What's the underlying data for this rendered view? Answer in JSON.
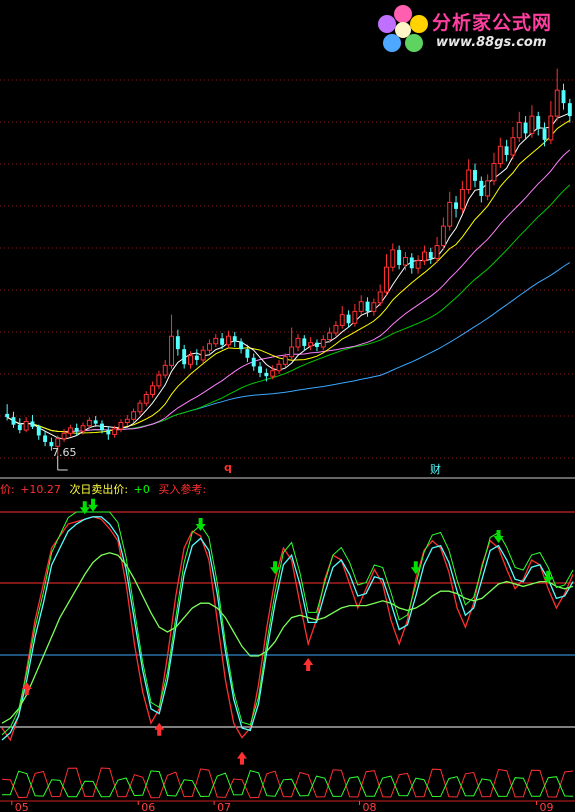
{
  "watermark": {
    "title": "分析家公式网",
    "url": "www.88gs.com"
  },
  "indicator_header": {
    "label_price": "价:",
    "value_price": "+10.27",
    "label_next": "次日卖出价:",
    "value_next": "+0",
    "label_buy": "买入参考:"
  },
  "annotations": {
    "low_price": "7.65",
    "marker_q": "q",
    "marker_cai": "财"
  },
  "colors": {
    "up": "#ff3232",
    "down": "#54ffff",
    "ma5": "#ffffff",
    "ma10": "#ffff00",
    "ma20": "#ff80ff",
    "ma30": "#00c800",
    "ma60": "#3aa8ff",
    "buy_arrow": "#ff3030",
    "sell_arrow": "#00e000"
  },
  "chart_data": [
    {
      "type": "candlestick",
      "title": "",
      "min_label": "7.65",
      "candles": [
        [
          9.6,
          9.45,
          10.05,
          9.3
        ],
        [
          9.45,
          9.1,
          9.7,
          8.95
        ],
        [
          9.1,
          8.85,
          9.4,
          8.7
        ],
        [
          8.85,
          9.25,
          9.45,
          8.75
        ],
        [
          9.25,
          9.0,
          9.55,
          8.9
        ],
        [
          9.0,
          8.6,
          9.1,
          8.4
        ],
        [
          8.6,
          8.3,
          8.8,
          8.1
        ],
        [
          8.3,
          8.1,
          8.5,
          7.9
        ],
        [
          8.1,
          8.45,
          8.6,
          7.65
        ],
        [
          8.45,
          8.7,
          8.9,
          8.3
        ],
        [
          8.7,
          8.95,
          9.1,
          8.55
        ],
        [
          8.95,
          8.8,
          9.15,
          8.6
        ],
        [
          8.8,
          9.05,
          9.2,
          8.65
        ],
        [
          9.05,
          9.3,
          9.45,
          8.9
        ],
        [
          9.3,
          9.15,
          9.5,
          9.0
        ],
        [
          9.15,
          8.85,
          9.3,
          8.7
        ],
        [
          8.85,
          8.65,
          9.0,
          8.4
        ],
        [
          8.65,
          8.9,
          9.05,
          8.5
        ],
        [
          8.9,
          9.2,
          9.35,
          8.75
        ],
        [
          9.2,
          9.35,
          9.55,
          9.05
        ],
        [
          9.35,
          9.7,
          9.85,
          9.2
        ],
        [
          9.7,
          10.1,
          10.25,
          9.55
        ],
        [
          10.1,
          10.5,
          10.65,
          9.95
        ],
        [
          10.5,
          10.9,
          11.1,
          10.35
        ],
        [
          10.9,
          11.4,
          11.6,
          10.75
        ],
        [
          11.4,
          11.85,
          12.1,
          11.25
        ],
        [
          11.85,
          13.2,
          14.2,
          11.7
        ],
        [
          13.2,
          12.6,
          13.5,
          12.3
        ],
        [
          12.6,
          11.9,
          12.8,
          11.7
        ],
        [
          11.9,
          12.3,
          12.5,
          11.7
        ],
        [
          12.3,
          12.1,
          12.6,
          11.85
        ],
        [
          12.1,
          12.55,
          12.75,
          11.95
        ],
        [
          12.55,
          12.85,
          13.05,
          12.4
        ],
        [
          12.85,
          13.1,
          13.3,
          12.7
        ],
        [
          13.1,
          12.8,
          13.35,
          12.6
        ],
        [
          12.8,
          13.2,
          13.45,
          12.65
        ],
        [
          13.2,
          12.95,
          13.4,
          12.7
        ],
        [
          12.95,
          12.6,
          13.1,
          12.4
        ],
        [
          12.6,
          12.2,
          12.8,
          12.0
        ],
        [
          12.2,
          11.8,
          12.4,
          11.6
        ],
        [
          11.8,
          11.5,
          12.0,
          11.3
        ],
        [
          11.5,
          11.35,
          11.7,
          11.1
        ],
        [
          11.35,
          11.6,
          11.85,
          11.2
        ],
        [
          11.6,
          11.9,
          12.1,
          11.45
        ],
        [
          11.9,
          12.25,
          12.4,
          11.75
        ],
        [
          12.25,
          12.7,
          13.6,
          12.1
        ],
        [
          12.7,
          13.1,
          13.3,
          12.5
        ],
        [
          13.1,
          12.75,
          13.25,
          12.55
        ],
        [
          12.75,
          12.9,
          13.15,
          12.55
        ],
        [
          12.9,
          12.7,
          13.05,
          12.5
        ],
        [
          12.7,
          13.05,
          13.25,
          12.55
        ],
        [
          13.05,
          13.35,
          13.6,
          12.9
        ],
        [
          13.35,
          13.7,
          13.9,
          13.2
        ],
        [
          13.7,
          14.2,
          14.6,
          13.55
        ],
        [
          14.2,
          13.8,
          14.4,
          13.6
        ],
        [
          13.8,
          14.35,
          14.7,
          13.65
        ],
        [
          14.35,
          14.8,
          15.1,
          14.2
        ],
        [
          14.8,
          14.35,
          15.0,
          14.1
        ],
        [
          14.35,
          14.75,
          14.95,
          14.15
        ],
        [
          14.75,
          15.25,
          15.6,
          14.6
        ],
        [
          15.25,
          16.4,
          17.0,
          15.1
        ],
        [
          16.4,
          17.2,
          17.5,
          16.2
        ],
        [
          17.2,
          16.5,
          17.4,
          16.3
        ],
        [
          16.5,
          16.85,
          17.1,
          16.25
        ],
        [
          16.85,
          16.35,
          17.05,
          16.1
        ],
        [
          16.35,
          16.7,
          16.95,
          16.1
        ],
        [
          16.7,
          17.1,
          17.4,
          16.5
        ],
        [
          17.1,
          16.8,
          17.3,
          16.55
        ],
        [
          16.8,
          17.4,
          17.8,
          16.6
        ],
        [
          17.4,
          18.3,
          18.7,
          17.2
        ],
        [
          18.3,
          19.4,
          19.9,
          18.1
        ],
        [
          19.4,
          19.1,
          19.7,
          18.7
        ],
        [
          19.1,
          20.0,
          20.4,
          18.9
        ],
        [
          20.0,
          20.9,
          21.4,
          19.8
        ],
        [
          20.9,
          20.4,
          21.2,
          20.1
        ],
        [
          20.4,
          19.7,
          20.6,
          19.4
        ],
        [
          19.7,
          20.4,
          20.7,
          19.5
        ],
        [
          20.4,
          21.2,
          21.7,
          20.2
        ],
        [
          21.2,
          22.0,
          22.4,
          21.0
        ],
        [
          22.0,
          21.6,
          22.3,
          21.3
        ],
        [
          21.6,
          22.4,
          22.9,
          21.4
        ],
        [
          22.4,
          23.1,
          23.6,
          22.2
        ],
        [
          23.1,
          22.6,
          23.4,
          22.3
        ],
        [
          22.6,
          23.4,
          23.9,
          22.4
        ],
        [
          23.4,
          22.8,
          23.6,
          22.5
        ],
        [
          22.8,
          22.3,
          23.1,
          22.0
        ],
        [
          22.3,
          23.4,
          24.1,
          22.1
        ],
        [
          23.4,
          24.6,
          25.6,
          23.2
        ],
        [
          24.6,
          24.0,
          24.9,
          23.7
        ],
        [
          24.0,
          23.4,
          24.2,
          23.1
        ]
      ],
      "ylim": [
        7.0,
        26.0
      ]
    },
    {
      "type": "line",
      "title": "",
      "series": [
        {
          "values": [
            0.1,
            0.05,
            0.15,
            0.35,
            0.55,
            0.7,
            0.85,
            0.9,
            0.95,
            0.96,
            0.97,
            0.98,
            0.97,
            0.93,
            0.88,
            0.7,
            0.45,
            0.25,
            0.12,
            0.18,
            0.4,
            0.65,
            0.85,
            0.92,
            0.9,
            0.8,
            0.55,
            0.3,
            0.12,
            0.06,
            0.1,
            0.28,
            0.52,
            0.72,
            0.85,
            0.8,
            0.62,
            0.45,
            0.55,
            0.72,
            0.82,
            0.8,
            0.7,
            0.6,
            0.68,
            0.76,
            0.7,
            0.55,
            0.45,
            0.55,
            0.72,
            0.84,
            0.88,
            0.85,
            0.75,
            0.6,
            0.52,
            0.62,
            0.78,
            0.88,
            0.85,
            0.76,
            0.68,
            0.72,
            0.8,
            0.78,
            0.68,
            0.6,
            0.66,
            0.74
          ]
        },
        {
          "values": [
            0.05,
            0.08,
            0.15,
            0.3,
            0.48,
            0.62,
            0.78,
            0.85,
            0.92,
            0.95,
            0.97,
            0.98,
            0.98,
            0.95,
            0.9,
            0.76,
            0.55,
            0.34,
            0.18,
            0.16,
            0.3,
            0.52,
            0.74,
            0.86,
            0.89,
            0.84,
            0.66,
            0.42,
            0.22,
            0.1,
            0.09,
            0.2,
            0.42,
            0.62,
            0.78,
            0.82,
            0.7,
            0.54,
            0.54,
            0.66,
            0.77,
            0.8,
            0.74,
            0.65,
            0.66,
            0.73,
            0.72,
            0.62,
            0.51,
            0.53,
            0.65,
            0.78,
            0.85,
            0.86,
            0.79,
            0.67,
            0.57,
            0.6,
            0.72,
            0.84,
            0.86,
            0.8,
            0.72,
            0.71,
            0.77,
            0.78,
            0.72,
            0.64,
            0.65,
            0.71
          ]
        },
        {
          "values": [
            0.12,
            0.14,
            0.18,
            0.24,
            0.32,
            0.4,
            0.48,
            0.56,
            0.62,
            0.68,
            0.74,
            0.79,
            0.82,
            0.83,
            0.82,
            0.78,
            0.72,
            0.65,
            0.58,
            0.52,
            0.5,
            0.52,
            0.56,
            0.6,
            0.62,
            0.62,
            0.6,
            0.56,
            0.5,
            0.44,
            0.4,
            0.4,
            0.42,
            0.46,
            0.52,
            0.56,
            0.57,
            0.56,
            0.55,
            0.56,
            0.58,
            0.6,
            0.61,
            0.61,
            0.61,
            0.62,
            0.63,
            0.62,
            0.6,
            0.59,
            0.6,
            0.62,
            0.65,
            0.67,
            0.67,
            0.66,
            0.64,
            0.63,
            0.64,
            0.67,
            0.7,
            0.71,
            0.7,
            0.69,
            0.7,
            0.71,
            0.71,
            0.69,
            0.68,
            0.69
          ]
        }
      ],
      "buy_signals": [
        3,
        19,
        29,
        37
      ],
      "sell_signals": [
        10,
        11,
        24,
        33,
        50,
        60,
        66
      ]
    }
  ],
  "x_axis": {
    "months": [
      {
        "label": "05",
        "index": 2
      },
      {
        "label": "06",
        "index": 22
      },
      {
        "label": "07",
        "index": 34
      },
      {
        "label": "08",
        "index": 57
      },
      {
        "label": "09",
        "index": 85
      }
    ]
  }
}
